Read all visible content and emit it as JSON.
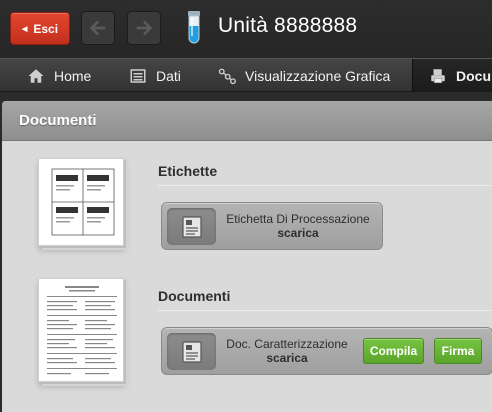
{
  "header": {
    "exit_label": "Esci",
    "unit_title": "Unità 8888888"
  },
  "tabs": [
    {
      "label": "Home",
      "icon": "home-icon"
    },
    {
      "label": "Dati",
      "icon": "list-icon"
    },
    {
      "label": "Visualizzazione Grafica",
      "icon": "chart-nodes-icon"
    },
    {
      "label": "Docu",
      "icon": "printer-icon",
      "active": true
    }
  ],
  "panel": {
    "title": "Documenti",
    "sections": [
      {
        "title": "Etichette",
        "items": [
          {
            "name": "Etichetta Di Processazione",
            "download": "scarica"
          }
        ]
      },
      {
        "title": "Documenti",
        "items": [
          {
            "name": "Doc. Caratterizzazione",
            "download": "scarica",
            "actions": [
              "Compila",
              "Firma"
            ]
          }
        ]
      }
    ]
  },
  "colors": {
    "exit_button": "#d23a25",
    "action_button": "#66b335",
    "panel_header": "#9a9a9a"
  }
}
